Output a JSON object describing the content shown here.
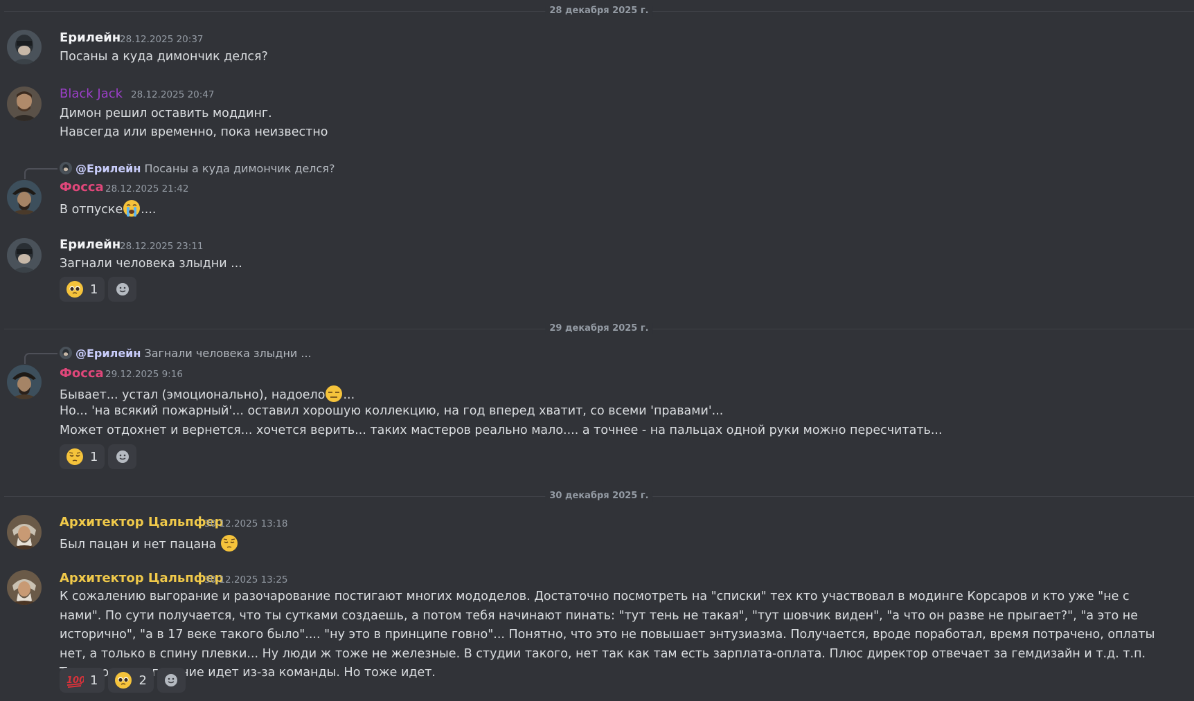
{
  "separators": {
    "dec28": "28 декабря 2025 г.",
    "dec29": "29 декабря 2025 г.",
    "dec30": "30 декабря 2025 г."
  },
  "messages": [
    {
      "author": "Ерилейн",
      "timestamp": "28.12.2025 20:37",
      "lines": [
        "Посаны а куда димончик делся?"
      ]
    },
    {
      "author": "Black Jack",
      "timestamp": "28.12.2025 20:47",
      "lines": [
        "Димон решил оставить моддинг.",
        "Навсегда или временно, пока неизвестно"
      ]
    },
    {
      "reply": {
        "mention": "@Ерилейн",
        "text": "Посаны а куда димончик делся?"
      },
      "author": "Фосса",
      "timestamp": "28.12.2025 21:42",
      "text_before": "В отпуске",
      "emoji": "loudly-crying-face",
      "text_after": "...."
    },
    {
      "author": "Ерилейн",
      "timestamp": "28.12.2025 23:11",
      "lines": [
        "Загнали человека злыдни ..."
      ],
      "reactions": [
        {
          "emoji": "pleading-face",
          "count": "1"
        }
      ]
    },
    {
      "reply": {
        "mention": "@Ерилейн",
        "text": "Загнали человека злыдни ..."
      },
      "author": "Фосса",
      "timestamp": "29.12.2025 9:16",
      "text_before": "Бывает... устал (эмоционально), надоело",
      "emoji": "expressionless-face",
      "text_after": "...",
      "lines": [
        "Но... 'на всякий пожарный'... оставил хорошую коллекцию, на год вперед хватит, со всеми 'правами'...",
        "Может отдохнет и вернется... хочется верить... таких мастеров реально мало.... а точнее - на пальцах одной руки можно пересчитать..."
      ],
      "reactions": [
        {
          "emoji": "pensive-face",
          "count": "1"
        }
      ]
    },
    {
      "author": "Архитектор Цальпфер",
      "timestamp": "30.12.2025 13:18",
      "text_before": "Был пацан и нет пацана",
      "emoji": "pensive-face"
    },
    {
      "author": "Архитектор Цальпфер",
      "timestamp": "30.12.2025 13:25",
      "body": "К сожалению выгорание и разочарование постигают многих мододелов. Достаточно посмотреть на \"списки\" тех кто участвовал в модинге Корсаров и кто уже \"не с нами\". По сути получается, что ты сутками создаешь, а потом тебя начинают пинать: \"тут тень не такая\", \"тут шовчик виден\", \"а что он разве не прыгает?\", \"а это не исторично\", \"а в 17 веке такого было\".... \"ну это в принципе говно\"...  Понятно, что это не повышает энтузиазма.  Получается, вроде поработал, время потрачено, оплаты нет, а только в спину плевки... Ну люди ж тоже не железные.  В студии такого, нет так как там есть зарплата-оплата. Плюс директор отвечает за гемдизайн и т.д. т.п. Там скорее выгорание идет из-за команды. Но тоже идет.",
      "reactions": [
        {
          "emoji": "hundred-points",
          "count": "1"
        },
        {
          "emoji": "pleading-face",
          "count": "2"
        }
      ]
    }
  ],
  "colors": {
    "background": "#313338",
    "text": "#dbdee1",
    "muted": "#949ba4",
    "role_purple": "#9b3fc8",
    "role_pink": "#e0477a",
    "role_gold": "#f0c94a"
  }
}
